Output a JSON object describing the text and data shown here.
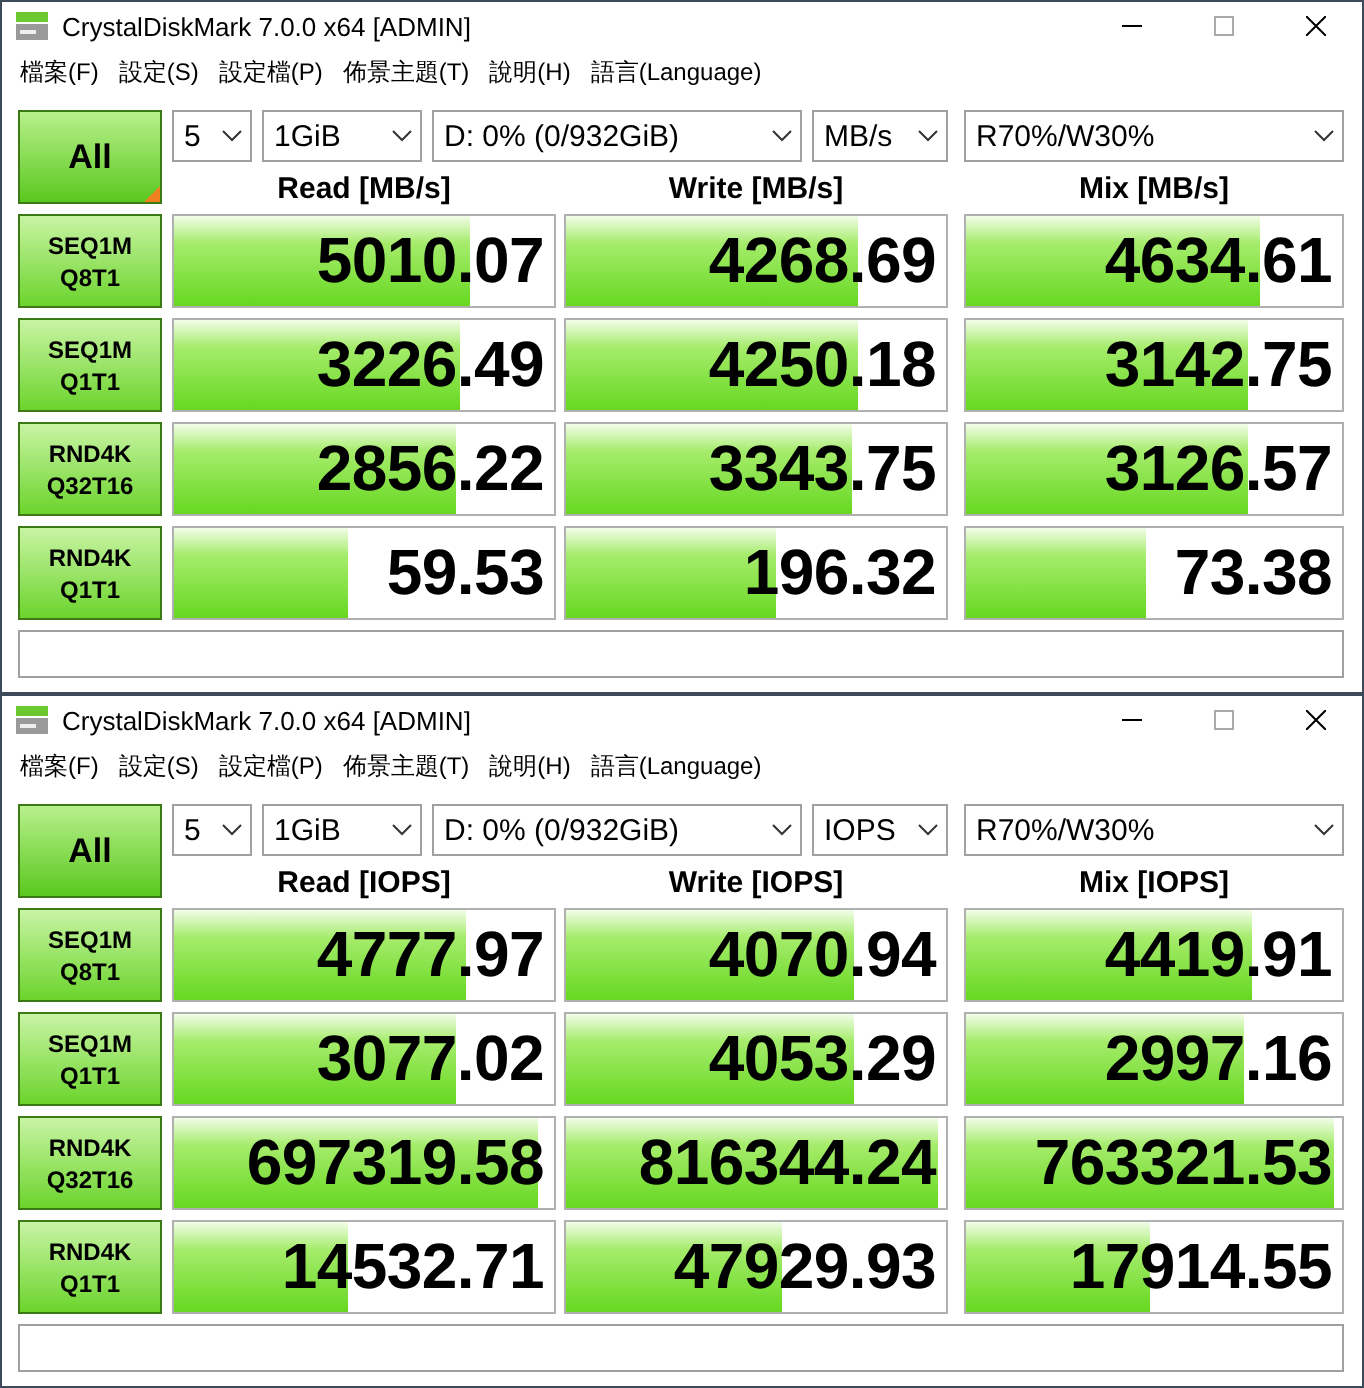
{
  "windows": [
    {
      "title": "CrystalDiskMark 7.0.0 x64 [ADMIN]",
      "menu": [
        "檔案(F)",
        "設定(S)",
        "設定檔(P)",
        "佈景主題(T)",
        "說明(H)",
        "語言(Language)"
      ],
      "all_button": {
        "label": "All",
        "marked": true
      },
      "settings": {
        "count": "5",
        "size": "1GiB",
        "drive": "D: 0% (0/932GiB)",
        "unit": "MB/s",
        "profile": "R70%/W30%"
      },
      "columns": [
        "Read [MB/s]",
        "Write [MB/s]",
        "Mix [MB/s]"
      ],
      "rows": [
        {
          "test": "SEQ1M",
          "params": "Q8T1",
          "results": [
            {
              "value": "5010.07",
              "level": 0.78
            },
            {
              "value": "4268.69",
              "level": 0.77
            },
            {
              "value": "4634.61",
              "level": 0.78
            }
          ]
        },
        {
          "test": "SEQ1M",
          "params": "Q1T1",
          "results": [
            {
              "value": "3226.49",
              "level": 0.75
            },
            {
              "value": "4250.18",
              "level": 0.77
            },
            {
              "value": "3142.75",
              "level": 0.75
            }
          ]
        },
        {
          "test": "RND4K",
          "params": "Q32T16",
          "results": [
            {
              "value": "2856.22",
              "level": 0.74
            },
            {
              "value": "3343.75",
              "level": 0.75
            },
            {
              "value": "3126.57",
              "level": 0.75
            }
          ]
        },
        {
          "test": "RND4K",
          "params": "Q1T1",
          "results": [
            {
              "value": "59.53",
              "level": 0.46
            },
            {
              "value": "196.32",
              "level": 0.55
            },
            {
              "value": "73.38",
              "level": 0.48
            }
          ]
        }
      ]
    },
    {
      "title": "CrystalDiskMark 7.0.0 x64 [ADMIN]",
      "menu": [
        "檔案(F)",
        "設定(S)",
        "設定檔(P)",
        "佈景主題(T)",
        "說明(H)",
        "語言(Language)"
      ],
      "all_button": {
        "label": "All",
        "marked": false
      },
      "settings": {
        "count": "5",
        "size": "1GiB",
        "drive": "D: 0% (0/932GiB)",
        "unit": "IOPS",
        "profile": "R70%/W30%"
      },
      "columns": [
        "Read [IOPS]",
        "Write [IOPS]",
        "Mix [IOPS]"
      ],
      "rows": [
        {
          "test": "SEQ1M",
          "params": "Q8T1",
          "results": [
            {
              "value": "4777.97",
              "level": 0.77
            },
            {
              "value": "4070.94",
              "level": 0.76
            },
            {
              "value": "4419.91",
              "level": 0.76
            }
          ]
        },
        {
          "test": "SEQ1M",
          "params": "Q1T1",
          "results": [
            {
              "value": "3077.02",
              "level": 0.74
            },
            {
              "value": "4053.29",
              "level": 0.76
            },
            {
              "value": "2997.16",
              "level": 0.74
            }
          ]
        },
        {
          "test": "RND4K",
          "params": "Q32T16",
          "results": [
            {
              "value": "697319.58",
              "level": 0.96
            },
            {
              "value": "816344.24",
              "level": 0.98
            },
            {
              "value": "763321.53",
              "level": 0.98
            }
          ]
        },
        {
          "test": "RND4K",
          "params": "Q1T1",
          "results": [
            {
              "value": "14532.71",
              "level": 0.46
            },
            {
              "value": "47929.93",
              "level": 0.57
            },
            {
              "value": "17914.55",
              "level": 0.49
            }
          ]
        }
      ]
    }
  ]
}
